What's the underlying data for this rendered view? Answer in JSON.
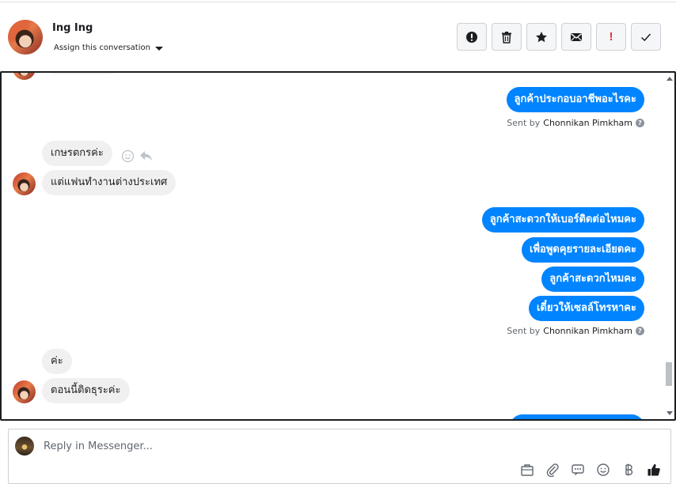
{
  "header": {
    "contact_name": "Ing Ing",
    "assign_label": "Assign this conversation",
    "toolbar": [
      "alert-icon",
      "trash-icon",
      "star-icon",
      "mail-icon",
      "exclamation-icon",
      "check-icon"
    ],
    "exclamation_glyph": "!"
  },
  "messages": {
    "m1": "ลูกค้าประกอบอาชีพอะไรคะ",
    "sent1_prefix": "Sent by",
    "sent1_name": "Chonnikan Pimkham",
    "m2": "เกษรตกรค่ะ",
    "m3": "แต่แฟนทำงานต่างประเทศ",
    "m4": "ลูกค้าสะดวกให้เบอร์ติดต่อไหมคะ",
    "m5": "เพื่อพูดคุยรายละเอียดคะ",
    "m6": "ลูกค้าสะดวกไหมคะ",
    "m7": "เดี๋ยวให้เซลล์โทรหาคะ",
    "sent2_prefix": "Sent by",
    "sent2_name": "Chonnikan Pimkham",
    "m8": "ค่ะ",
    "m9": "ตอนนี้ติดธุระค่ะ",
    "qmark": "?"
  },
  "reply": {
    "placeholder": "Reply in Messenger..."
  },
  "colors": {
    "outgoing_bubble": "#0084ff",
    "incoming_bubble": "#f0f0f0",
    "alert_red": "#e0313a"
  }
}
